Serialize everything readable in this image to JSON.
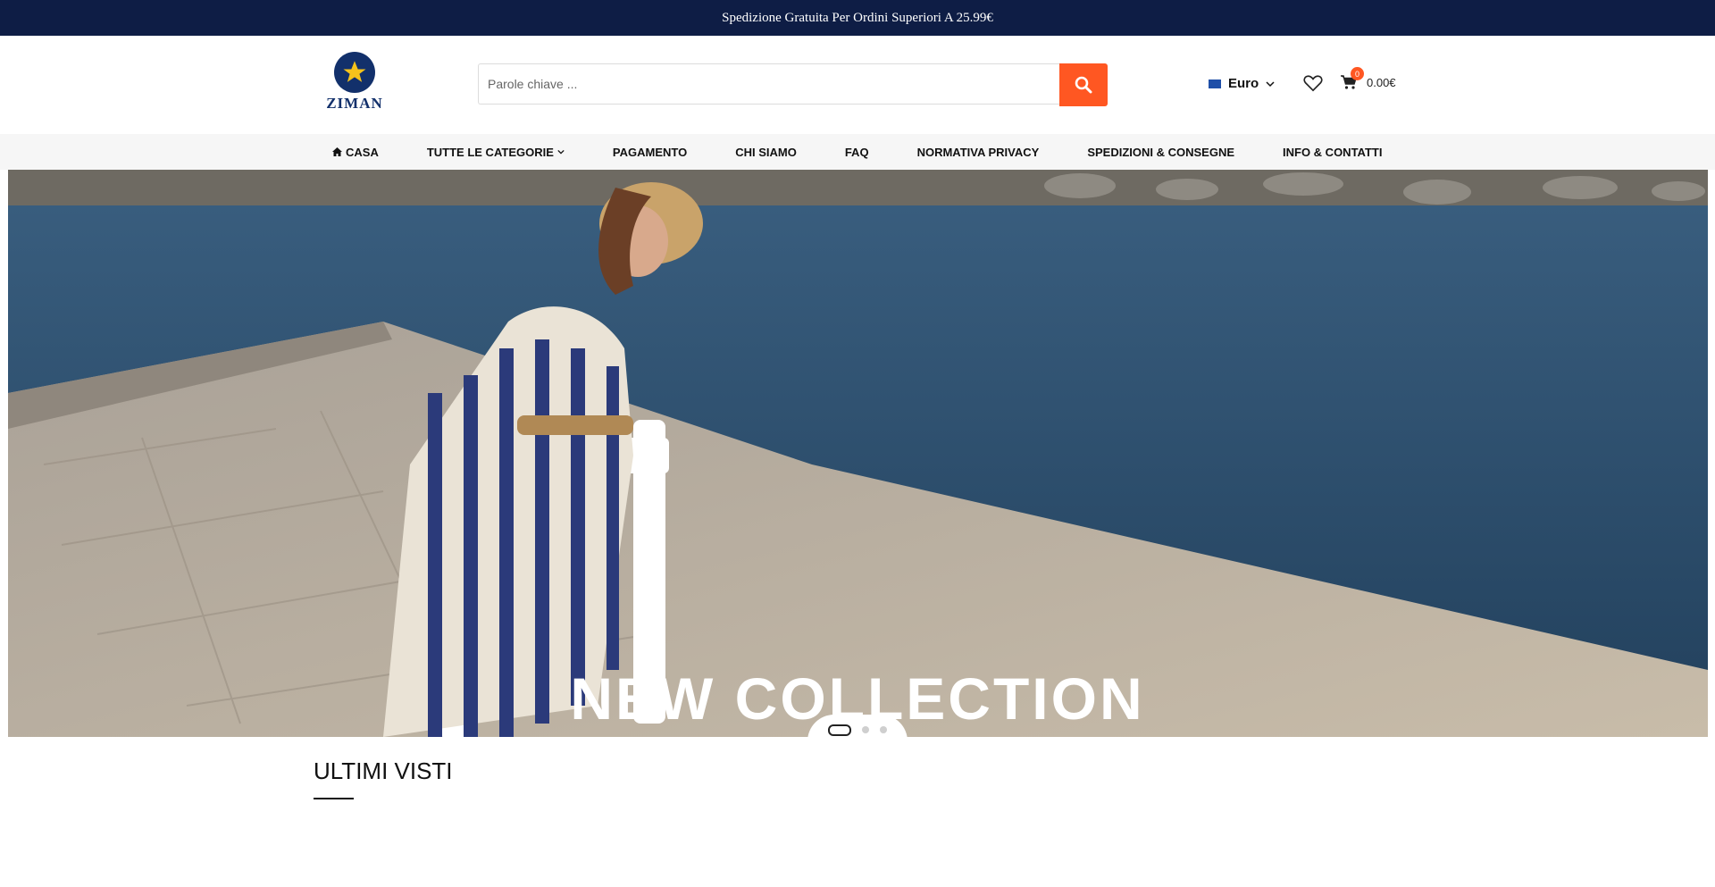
{
  "topbar": {
    "message": "Spedizione Gratuita Per Ordini Superiori A 25.99€"
  },
  "logo": {
    "text": "ZIMAN"
  },
  "search": {
    "placeholder": "Parole chiave ..."
  },
  "currency": {
    "label": "Euro"
  },
  "cart": {
    "count": "0",
    "total": "0.00€"
  },
  "nav": {
    "items": [
      {
        "label": "CASA"
      },
      {
        "label": "TUTTE LE CATEGORIE"
      },
      {
        "label": "PAGAMENTO"
      },
      {
        "label": "CHI SIAMO"
      },
      {
        "label": "FAQ"
      },
      {
        "label": "NORMATIVA PRIVACY"
      },
      {
        "label": "SPEDIZIONI & CONSEGNE"
      },
      {
        "label": "INFO & CONTATTI"
      }
    ]
  },
  "hero": {
    "caption": "NEW COLLECTION",
    "slide_count": 3,
    "active_slide": 1
  },
  "sections": {
    "recently_viewed_title": "ULTIMI VISTI"
  },
  "colors": {
    "topbar": "#0e1d45",
    "accent": "#ff5722",
    "water": "#2f5474",
    "pier": "#bdb2a3"
  }
}
